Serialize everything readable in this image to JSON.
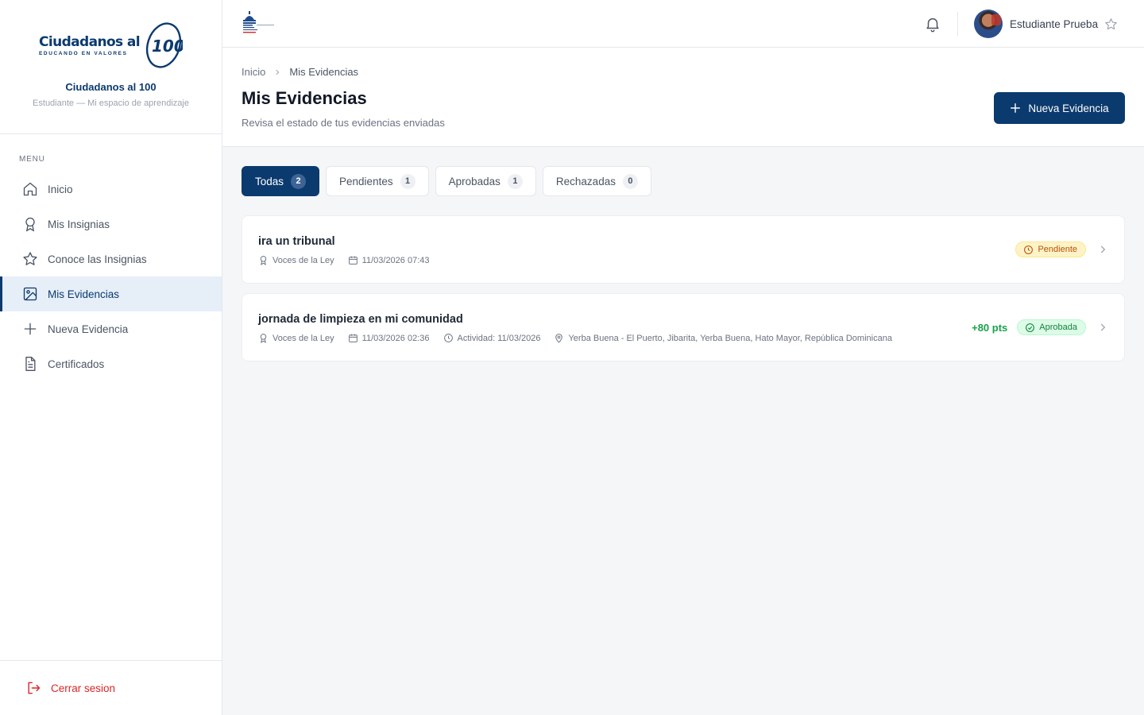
{
  "brand": {
    "logo_text": "Ciudadanos al",
    "logo_sub": "EDUCANDO EN VALORES",
    "logo_number": "100",
    "name": "Ciudadanos al 100",
    "tagline": "Estudiante — Mi espacio de aprendizaje"
  },
  "sidebar": {
    "menu_label": "MENU",
    "items": [
      {
        "label": "Inicio",
        "icon": "home-icon",
        "active": false
      },
      {
        "label": "Mis Insignias",
        "icon": "award-icon",
        "active": false
      },
      {
        "label": "Conoce las Insignias",
        "icon": "star-icon",
        "active": false
      },
      {
        "label": "Mis Evidencias",
        "icon": "image-icon",
        "active": true
      },
      {
        "label": "Nueva Evidencia",
        "icon": "plus-icon",
        "active": false
      },
      {
        "label": "Certificados",
        "icon": "document-icon",
        "active": false
      }
    ],
    "logout_label": "Cerrar sesion"
  },
  "topbar": {
    "user_name": "Estudiante Prueba"
  },
  "breadcrumb": {
    "home": "Inicio",
    "current": "Mis Evidencias"
  },
  "page": {
    "title": "Mis Evidencias",
    "subtitle": "Revisa el estado de tus evidencias enviadas",
    "new_button": "Nueva Evidencia"
  },
  "tabs": [
    {
      "label": "Todas",
      "count": "2",
      "active": true
    },
    {
      "label": "Pendientes",
      "count": "1",
      "active": false
    },
    {
      "label": "Aprobadas",
      "count": "1",
      "active": false
    },
    {
      "label": "Rechazadas",
      "count": "0",
      "active": false
    }
  ],
  "evidences": [
    {
      "title": "ira un tribunal",
      "badge_name": "Voces de la Ley",
      "date": "11/03/2026 07:43",
      "status": "Pendiente"
    },
    {
      "title": "jornada de limpieza en mi comunidad",
      "badge_name": "Voces de la Ley",
      "date": "11/03/2026 02:36",
      "activity": "Actividad: 11/03/2026",
      "location": "Yerba Buena - El Puerto, Jibarita, Yerba Buena, Hato Mayor, República Dominicana",
      "points": "+80 pts",
      "status": "Aprobada"
    }
  ],
  "colors": {
    "primary": "#0b3a6e",
    "pending": "#b45309",
    "approved": "#15803d",
    "danger": "#dc2626"
  }
}
